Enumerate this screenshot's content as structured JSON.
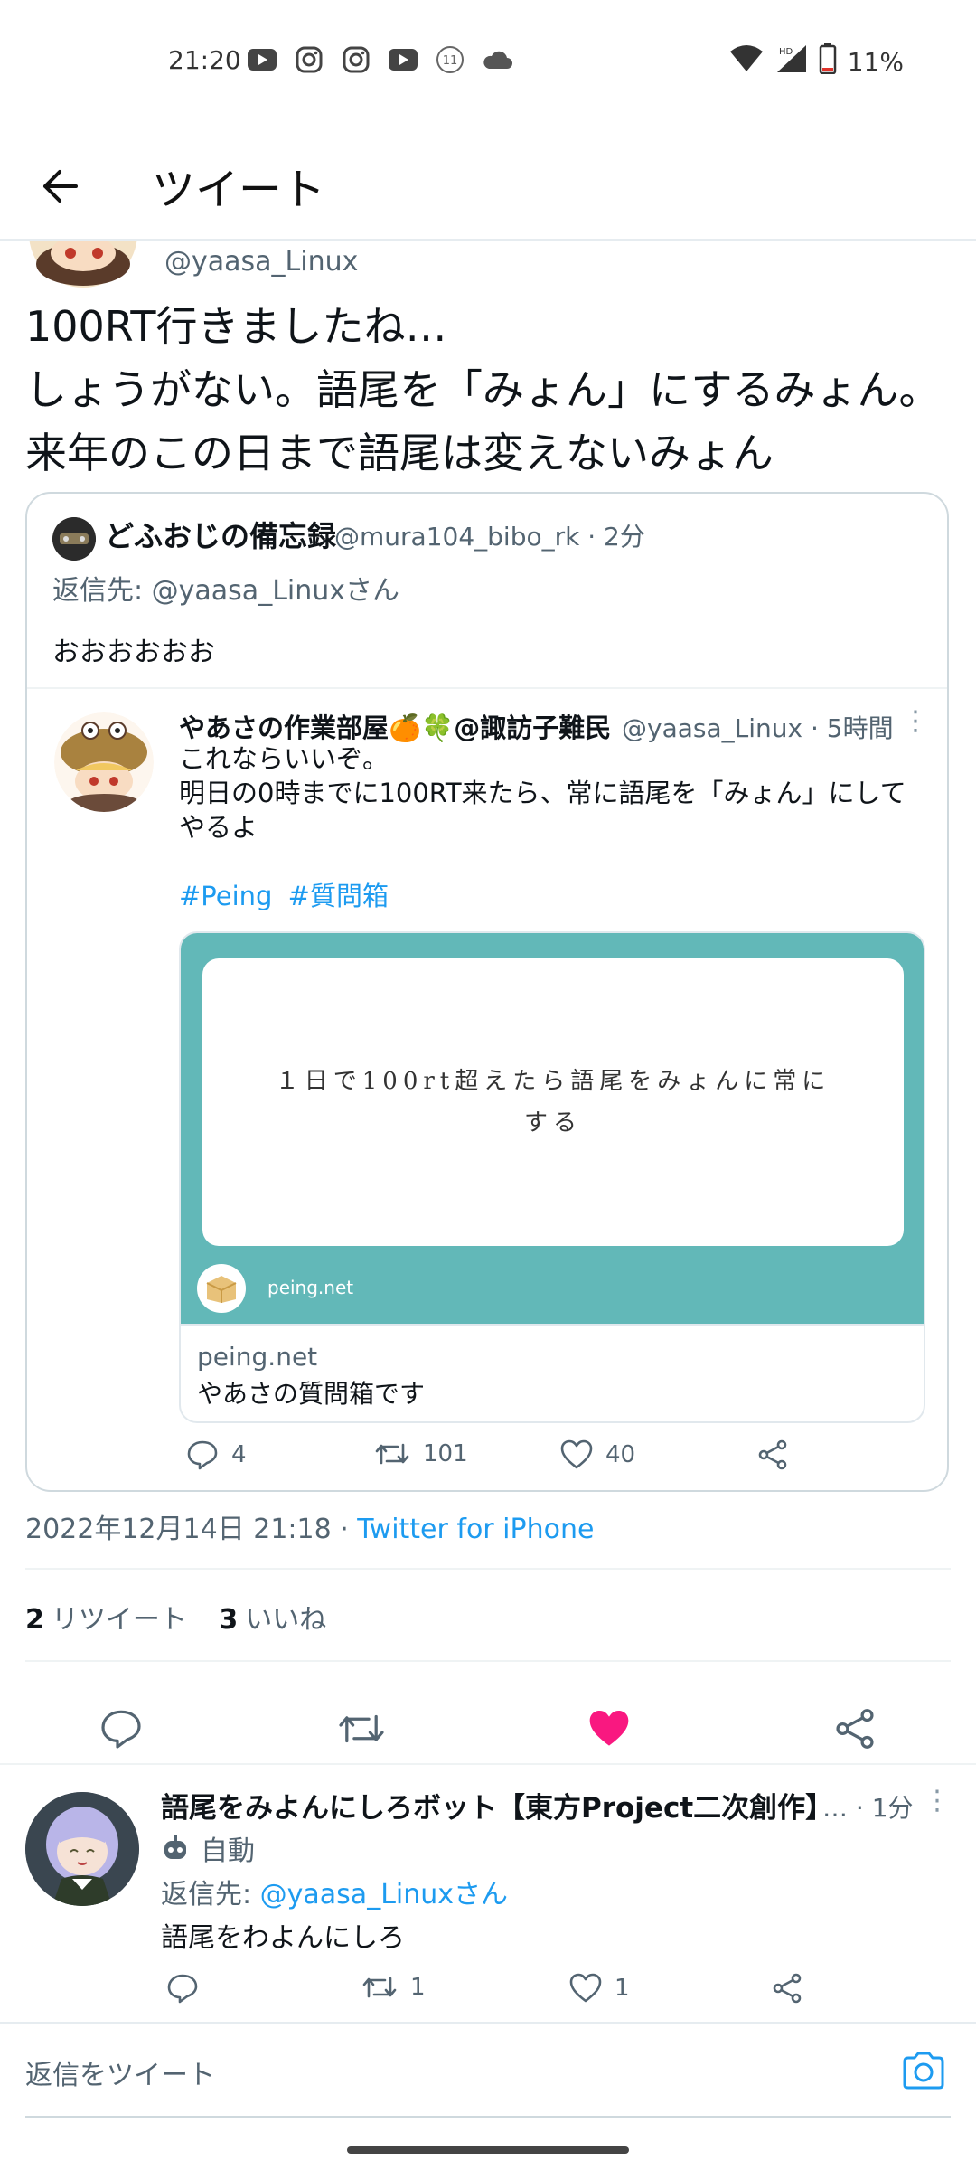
{
  "status_bar": {
    "time": "21:20",
    "left_icons": [
      "youtube-icon",
      "instagram-icon",
      "instagram-icon",
      "youtube-icon",
      "notification-count-icon",
      "cloud-icon"
    ],
    "notification_count": "11",
    "network_label": "HD",
    "battery": "11%"
  },
  "header": {
    "title": "ツイート"
  },
  "main_tweet": {
    "handle": "@yaasa_Linux",
    "text_lines": [
      "100RT行きましたね…",
      "しょうがない。語尾を「みょん」にするみょん。",
      "来年のこの日まで語尾は変えないみょん"
    ]
  },
  "quote": {
    "name": "どふおじの備忘録",
    "handle": "@mura104_bibo_rk",
    "time": "2分",
    "reply_to_label": "返信先:",
    "reply_to": "@yaasa_Linuxさん",
    "text": "おおおおおお",
    "inner": {
      "name": "やあさの作業部屋🍊🍀@諏訪子難民",
      "handle": "@yaasa_Linux",
      "time": "5時間",
      "text_lines": [
        "これならいいぞ。",
        "明日の0時までに100RT来たら、常に語尾を「みょん」にして",
        "やるよ"
      ],
      "hashtags": [
        "#Peing",
        "#質問箱"
      ],
      "card": {
        "question_lines": [
          "１日で100rt超えたら語尾をみょんに常に",
          "する"
        ],
        "image_domain": "peing.net",
        "domain": "peing.net",
        "title": "やあさの質問箱です"
      }
    },
    "actions": {
      "replies": "4",
      "retweets": "101",
      "likes": "40"
    }
  },
  "timestamp": {
    "date": "2022年12月14日 21:18",
    "separator": " · ",
    "via": "Twitter for iPhone"
  },
  "stats": {
    "retweets_count": "2",
    "retweets_label": "リツイート",
    "likes_count": "3",
    "likes_label": "いいね"
  },
  "colors": {
    "accent": "#1d9bf0",
    "like": "#f91880",
    "teal_card": "#62b8b8",
    "muted": "#536471"
  },
  "reply": {
    "name": "語尾をみよんにしろボット【東方Project二次創作】",
    "ellipsis": "…",
    "time": "1分",
    "auto_label": "自動",
    "reply_to_label": "返信先:",
    "reply_to": "@yaasa_Linuxさん",
    "text": "語尾をわよんにしろ",
    "actions": {
      "replies": "",
      "retweets": "1",
      "likes": "1"
    }
  },
  "reply_box": {
    "placeholder": "返信をツイート"
  }
}
